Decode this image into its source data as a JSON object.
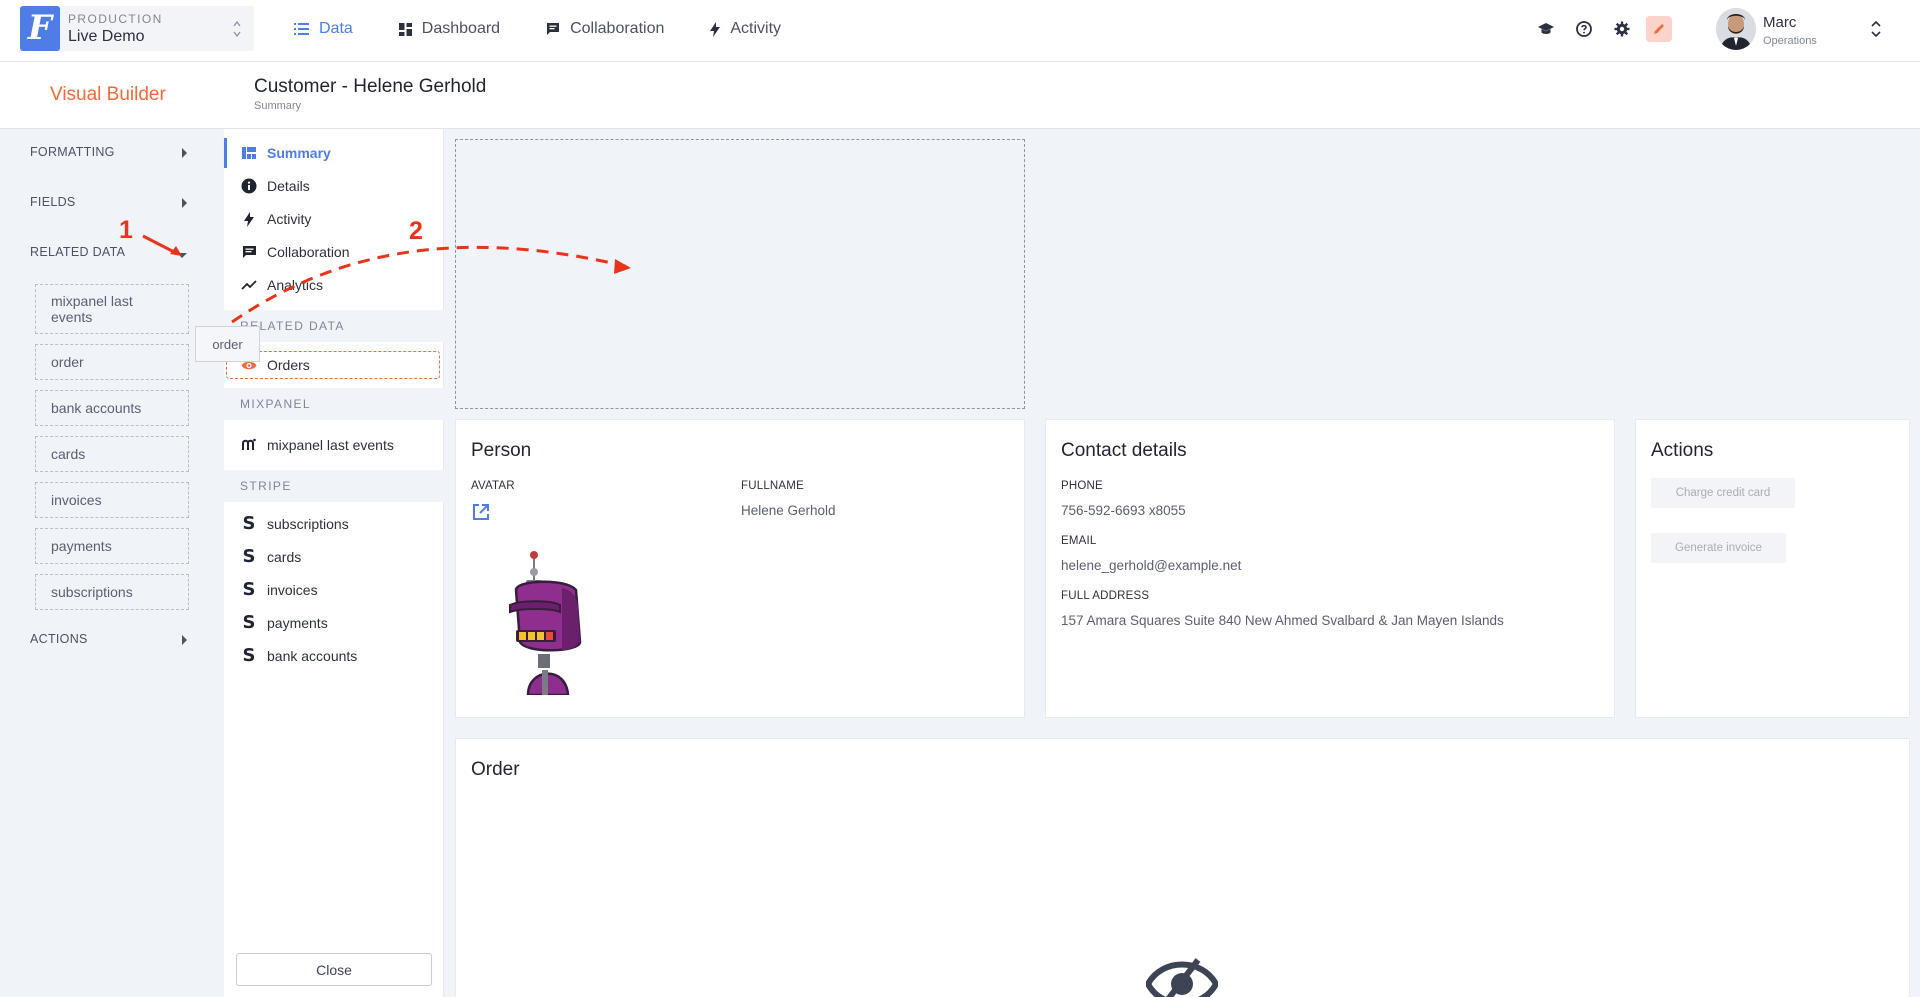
{
  "topbar": {
    "project_env": "PRODUCTION",
    "project_name": "Live Demo",
    "logo_letter": "F",
    "nav": [
      {
        "label": "Data",
        "icon": "list-icon",
        "active": true
      },
      {
        "label": "Dashboard",
        "icon": "dashboard-icon",
        "active": false
      },
      {
        "label": "Collaboration",
        "icon": "chat-icon",
        "active": false
      },
      {
        "label": "Activity",
        "icon": "bolt-icon",
        "active": false
      }
    ],
    "icons": [
      "graduation-cap-icon",
      "help-icon",
      "gear-icon",
      "pencil-icon"
    ],
    "user": {
      "name": "Marc",
      "role": "Operations"
    }
  },
  "header": {
    "builder_title": "Visual Builder",
    "page_title": "Customer - Helene Gerhold",
    "page_subtitle": "Summary"
  },
  "left_panel": {
    "sections": {
      "formatting": "FORMATTING",
      "fields": "FIELDS",
      "related_data": "RELATED DATA",
      "actions": "ACTIONS"
    },
    "related_items": [
      "mixpanel last events",
      "order",
      "bank accounts",
      "cards",
      "invoices",
      "payments",
      "subscriptions"
    ],
    "drag_ghost": "order"
  },
  "annotations": {
    "step1": "1",
    "step2": "2",
    "color": "#e8341c"
  },
  "middle_panel": {
    "items": [
      "Summary",
      "Details",
      "Activity",
      "Collaboration",
      "Analytics"
    ],
    "related_group": "RELATED DATA",
    "orders": "Orders",
    "mixpanel_group": "MIXPANEL",
    "mixpanel_item": "mixpanel last events",
    "stripe_group": "STRIPE",
    "stripe_items": [
      "subscriptions",
      "cards",
      "invoices",
      "payments",
      "bank accounts"
    ],
    "close": "Close"
  },
  "cards": {
    "person": {
      "title": "Person",
      "avatar_label": "AVATAR",
      "fullname_label": "FULLNAME",
      "fullname": "Helene Gerhold"
    },
    "contact": {
      "title": "Contact details",
      "phone_label": "PHONE",
      "phone": "756-592-6693 x8055",
      "email_label": "EMAIL",
      "email": "helene_gerhold@example.net",
      "address_label": "FULL ADDRESS",
      "address": "157 Amara Squares Suite 840 New Ahmed Svalbard & Jan Mayen Islands"
    },
    "actions": {
      "title": "Actions",
      "charge": "Charge credit card",
      "invoice": "Generate invoice"
    },
    "order": {
      "title": "Order"
    }
  },
  "colors": {
    "accent": "#4e7de8",
    "brand_orange": "#ee6a3a",
    "robot_purple": "#8e2f8f"
  }
}
